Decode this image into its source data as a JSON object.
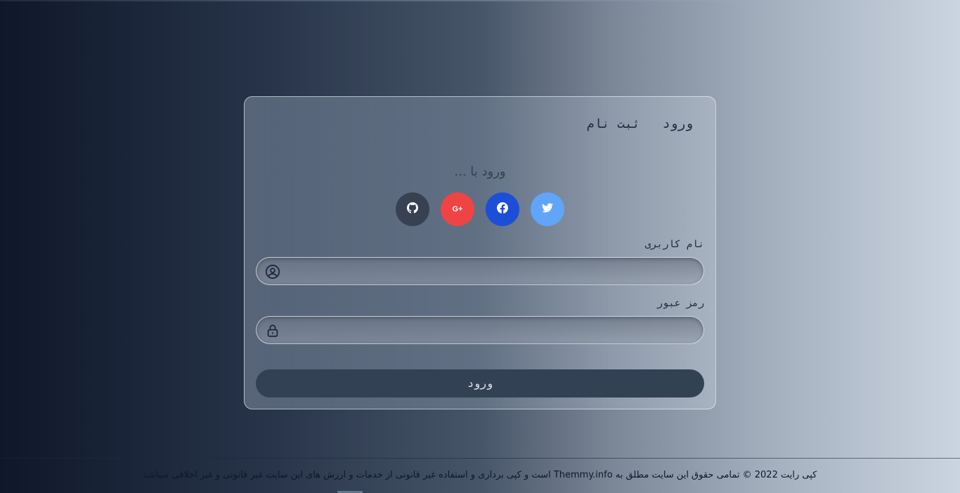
{
  "tabs": {
    "login": "ورود",
    "register": "ثبت نام"
  },
  "social": {
    "heading": "ورود با ...",
    "buttons": [
      {
        "name": "github",
        "icon": "github-icon",
        "color": "#374151"
      },
      {
        "name": "google-plus",
        "icon": "google-plus-icon",
        "label": "G+",
        "color": "#ef4444"
      },
      {
        "name": "facebook",
        "icon": "facebook-icon",
        "color": "#1d4ed8"
      },
      {
        "name": "twitter",
        "icon": "twitter-icon",
        "color": "#60a5fa"
      }
    ]
  },
  "form": {
    "username": {
      "label": "نام کاربری",
      "value": "",
      "placeholder": "",
      "icon": "user-circle-icon"
    },
    "password": {
      "label": "رمز عبور",
      "value": "",
      "placeholder": "",
      "icon": "lock-icon"
    },
    "submit_label": "ورود"
  },
  "footer": {
    "text": "کپی رایت 2022 © تمامی حقوق این سایت مطلق به Themmy.info است و کپی برداری و استفاده غیر قانونی از خدمات و ارزش های این سایت غیر قانونی و غیر اخلاقی میباشد"
  },
  "colors": {
    "primary_button": "#334155",
    "text_dark": "#1e293b"
  }
}
